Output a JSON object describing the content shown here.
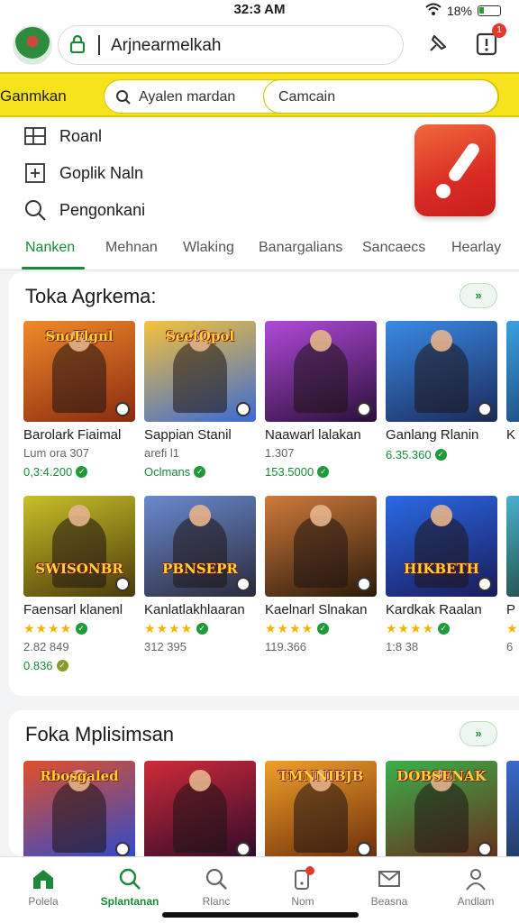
{
  "status": {
    "time": "32:3 AM",
    "battery": "18%"
  },
  "header": {
    "url_text": "Arjnearmelkah",
    "notification_count": "1"
  },
  "search": {
    "label": "Ganmkan",
    "placeholder1": "Ayalen mardan",
    "placeholder2": "Camcain"
  },
  "menu": {
    "items": [
      {
        "label": "Roanl",
        "icon": "grid-icon"
      },
      {
        "label": "Goplik Naln",
        "icon": "plus-box-icon"
      },
      {
        "label": "Pengonkani",
        "icon": "search-icon"
      }
    ]
  },
  "tabs": [
    "Nanken",
    "Mehnan",
    "Wlaking",
    "Banargalians",
    "Sancaecs",
    "Hearlay"
  ],
  "section1": {
    "title": "Toka Agrkema:",
    "more_label": "»",
    "row1": [
      {
        "name": "Barolark Fiaimal",
        "meta": "Lum ora 307",
        "price": "0,3:4.200",
        "banner": "SnoFlgnl",
        "colors": [
          "#f08a2a",
          "#8a2a10"
        ]
      },
      {
        "name": "Sappian Stanil",
        "meta": "arefi l1",
        "price": "Oclmans",
        "banner": "SeetQpol",
        "colors": [
          "#f5c23a",
          "#3a6ad6"
        ]
      },
      {
        "name": "Naawarl lalakan",
        "meta": "1.307",
        "price": "153.5000",
        "banner": "",
        "colors": [
          "#b04ad8",
          "#2a0f3a"
        ]
      },
      {
        "name": "Ganlang Rlanin",
        "meta": "",
        "price": "6.35.360",
        "banner": "",
        "colors": [
          "#3a8ae6",
          "#1a2a5a"
        ]
      },
      {
        "name": "K",
        "meta": "",
        "price": "",
        "banner": "",
        "colors": [
          "#3aa0e0",
          "#1a3a6a"
        ]
      }
    ],
    "row2": [
      {
        "name": "Faensarl klanenl",
        "count": "2.82 849",
        "price": "0.836",
        "banner": "SWISONBR",
        "colors": [
          "#c8c028",
          "#4a3a0a"
        ]
      },
      {
        "name": "Kanlatlakhlaaran",
        "count": "312 395",
        "price": "",
        "banner": "PBNSEPR",
        "colors": [
          "#6a8ad0",
          "#2a2a3a"
        ]
      },
      {
        "name": "Kaelnarl Slnakan",
        "count": "119.366",
        "price": "",
        "banner": "",
        "colors": [
          "#d07a3a",
          "#2a1a0a"
        ]
      },
      {
        "name": "Kardkak Raalan",
        "count": "1:8 38",
        "price": "",
        "banner": "HIKBETH",
        "colors": [
          "#2a6ae6",
          "#1a1a5a"
        ]
      },
      {
        "name": "P",
        "count": "6",
        "price": "",
        "banner": "",
        "colors": [
          "#4ab0d0",
          "#1a3a2a"
        ]
      }
    ]
  },
  "section2": {
    "title": "Foka Mplisimsan",
    "more_label": "»",
    "items": [
      {
        "banner": "Rbosgaled",
        "colors": [
          "#e0502a",
          "#2a4ad0"
        ]
      },
      {
        "banner": "",
        "colors": [
          "#d02a3a",
          "#2a0a2a"
        ]
      },
      {
        "banner": "TMNNIBJB",
        "colors": [
          "#f0a02a",
          "#6a2a0a"
        ]
      },
      {
        "banner": "DOBSENAK",
        "colors": [
          "#3ab04a",
          "#6a2a1a"
        ]
      },
      {
        "banner": "",
        "colors": [
          "#3a6ad0",
          "#1a2a3a"
        ]
      }
    ]
  },
  "bottom_nav": [
    {
      "label": "Polela",
      "icon": "home-icon",
      "active": false
    },
    {
      "label": "Splantanan",
      "icon": "search-icon",
      "active": true
    },
    {
      "label": "Rlanc",
      "icon": "search-icon",
      "active": false
    },
    {
      "label": "Nom",
      "icon": "phone-icon",
      "active": false
    },
    {
      "label": "Beasna",
      "icon": "mail-icon",
      "active": false
    },
    {
      "label": "Andlam",
      "icon": "person-icon",
      "active": false
    }
  ],
  "colors": {
    "accent": "#1a8a3a",
    "search_band": "#f6e31c",
    "rating": "#f4b400"
  }
}
